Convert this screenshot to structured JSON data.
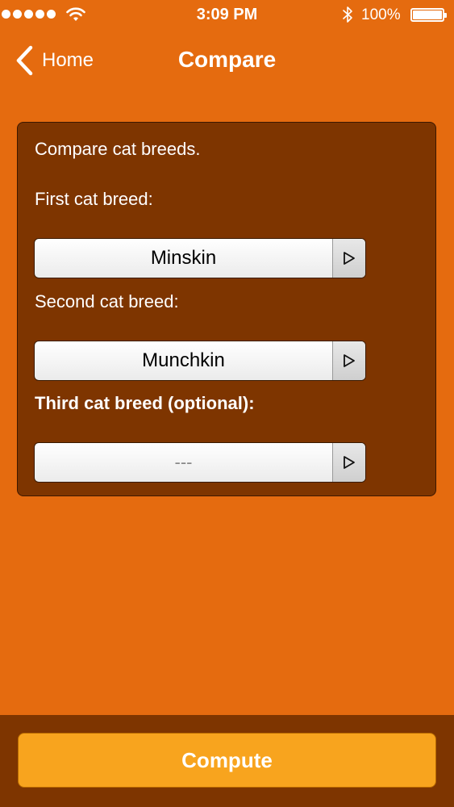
{
  "status_bar": {
    "time": "3:09 PM",
    "battery": "100%",
    "icons": [
      "signal-dots-icon",
      "wifi-icon",
      "bluetooth-icon",
      "battery-icon"
    ]
  },
  "nav": {
    "back_label": "Home",
    "title": "Compare",
    "back_icon": "chevron-left-icon"
  },
  "form": {
    "intro": "Compare cat breeds.",
    "first_label": "First cat breed:",
    "first_value": "Minskin",
    "second_label": "Second cat breed:",
    "second_value": "Munchkin",
    "third_label": "Third cat breed (optional):",
    "third_value": "---",
    "picker_icon": "play-triangle-icon"
  },
  "toolbar": {
    "compute_label": "Compute"
  },
  "colors": {
    "background": "#e56b0f",
    "panel": "#7e3500",
    "compute_button": "#f8a41e"
  }
}
